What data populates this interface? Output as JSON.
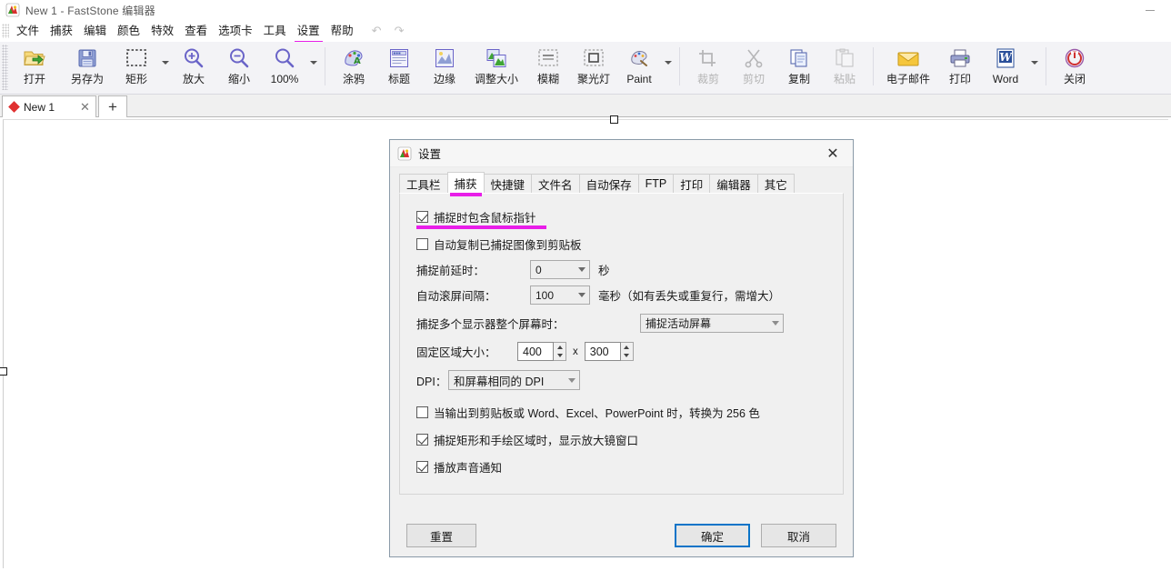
{
  "window": {
    "title": "New 1 - FastStone 编辑器",
    "app_icon": "faststone-logo-icon",
    "minimize_label": "—"
  },
  "menubar": {
    "items": [
      {
        "label": "文件",
        "name": "menu-file",
        "highlighted": false
      },
      {
        "label": "捕获",
        "name": "menu-capture",
        "highlighted": false
      },
      {
        "label": "编辑",
        "name": "menu-edit",
        "highlighted": false
      },
      {
        "label": "颜色",
        "name": "menu-color",
        "highlighted": false
      },
      {
        "label": "特效",
        "name": "menu-effects",
        "highlighted": false
      },
      {
        "label": "查看",
        "name": "menu-view",
        "highlighted": false
      },
      {
        "label": "选项卡",
        "name": "menu-tabs",
        "highlighted": false
      },
      {
        "label": "工具",
        "name": "menu-tools",
        "highlighted": false
      },
      {
        "label": "设置",
        "name": "menu-settings",
        "highlighted": true
      },
      {
        "label": "帮助",
        "name": "menu-help",
        "highlighted": false
      }
    ],
    "undo_icon": "undo-arrow-icon",
    "redo_icon": "redo-arrow-icon",
    "highlight_color": "#e81ee8"
  },
  "toolbar": {
    "items": [
      {
        "label": "打开",
        "icon": "open-folder-icon",
        "disabled": false
      },
      {
        "label": "另存为",
        "icon": "save-floppy-icon",
        "disabled": false
      },
      {
        "label": "矩形",
        "icon": "rectangle-select-icon",
        "disabled": false,
        "dropdown": true
      },
      {
        "label": "放大",
        "icon": "zoom-in-icon",
        "disabled": false
      },
      {
        "label": "缩小",
        "icon": "zoom-out-icon",
        "disabled": false
      },
      {
        "label": "100%",
        "icon": "zoom-actual-icon",
        "disabled": false,
        "dropdown": true
      },
      {
        "label": "涂鸦",
        "icon": "draw-board-icon",
        "disabled": false
      },
      {
        "label": "标题",
        "icon": "caption-icon",
        "disabled": false
      },
      {
        "label": "边缘",
        "icon": "edge-effect-icon",
        "disabled": false
      },
      {
        "label": "调整大小",
        "icon": "resize-icon",
        "disabled": false
      },
      {
        "label": "模糊",
        "icon": "blur-icon",
        "disabled": false
      },
      {
        "label": "聚光灯",
        "icon": "spotlight-icon",
        "disabled": false
      },
      {
        "label": "Paint",
        "icon": "paint-palette-icon",
        "disabled": false,
        "dropdown": true
      },
      {
        "label": "裁剪",
        "icon": "crop-icon",
        "disabled": true
      },
      {
        "label": "剪切",
        "icon": "scissors-icon",
        "disabled": true
      },
      {
        "label": "复制",
        "icon": "copy-icon",
        "disabled": false
      },
      {
        "label": "粘贴",
        "icon": "paste-icon",
        "disabled": true
      },
      {
        "label": "电子邮件",
        "icon": "email-envelope-icon",
        "disabled": false
      },
      {
        "label": "打印",
        "icon": "printer-icon",
        "disabled": false
      },
      {
        "label": "Word",
        "icon": "word-document-icon",
        "disabled": false,
        "dropdown": true
      },
      {
        "label": "关闭",
        "icon": "power-close-icon",
        "disabled": false
      }
    ]
  },
  "doctabs": {
    "tabs": [
      {
        "label": "New 1",
        "close_icon": "close-x-icon",
        "marker_icon": "modified-dot-icon"
      }
    ],
    "add_label": "+"
  },
  "dialog": {
    "title": "设置",
    "icon": "faststone-logo-icon",
    "close_icon": "close-x-icon",
    "tabs": [
      {
        "label": "工具栏",
        "active": false
      },
      {
        "label": "捕获",
        "active": true
      },
      {
        "label": "快捷键",
        "active": false
      },
      {
        "label": "文件名",
        "active": false
      },
      {
        "label": "自动保存",
        "active": false
      },
      {
        "label": "FTP",
        "active": false
      },
      {
        "label": "打印",
        "active": false
      },
      {
        "label": "编辑器",
        "active": false
      },
      {
        "label": "其它",
        "active": false
      }
    ],
    "capture": {
      "cb_include_cursor": {
        "label": "捕捉时包含鼠标指针",
        "checked": true,
        "highlighted": true
      },
      "cb_auto_copy": {
        "label": "自动复制已捕捉图像到剪贴板",
        "checked": false
      },
      "delay": {
        "label": "捕捉前延时：",
        "value": "0",
        "unit": "秒"
      },
      "scroll_interval": {
        "label": "自动滚屏间隔：",
        "value": "100",
        "unit": "毫秒（如有丢失或重复行，需增大）"
      },
      "multi_monitor": {
        "label": "捕捉多个显示器整个屏幕时：",
        "value": "捕捉活动屏幕"
      },
      "fixed_region": {
        "label": "固定区域大小：",
        "width": "400",
        "sep": "x",
        "height": "300"
      },
      "dpi": {
        "label": "DPI：",
        "value": "和屏幕相同的 DPI"
      },
      "cb_256color": {
        "label": "当输出到剪贴板或 Word、Excel、PowerPoint 时，转换为 256 色",
        "checked": false
      },
      "cb_magnifier": {
        "label": "捕捉矩形和手绘区域时，显示放大镜窗口",
        "checked": true
      },
      "cb_sound": {
        "label": "播放声音通知",
        "checked": true
      }
    },
    "buttons": {
      "reset": "重置",
      "ok": "确定",
      "cancel": "取消"
    }
  },
  "colors": {
    "accent_highlight": "#e81ee8",
    "primary_button_border": "#0a74c8",
    "toolbar_bg": "#f3f3f6",
    "dialog_bg": "#f0f0f0"
  }
}
